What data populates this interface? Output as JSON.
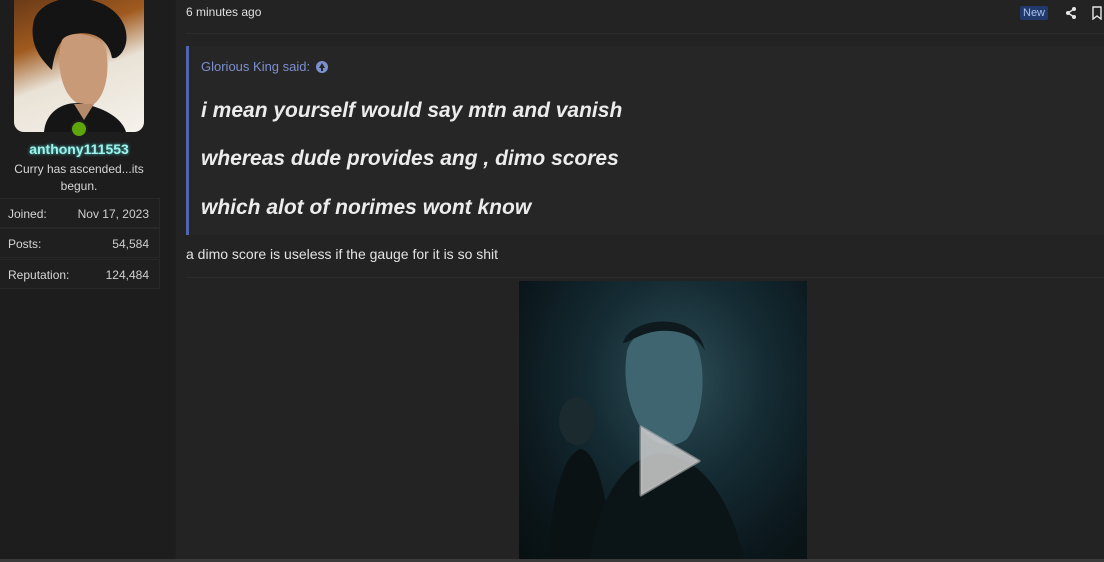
{
  "sidebar": {
    "username": "anthony111553",
    "user_title": "Curry has ascended...its begun.",
    "stats": [
      {
        "label": "Joined:",
        "value": "Nov 17, 2023"
      },
      {
        "label": "Posts:",
        "value": "54,584"
      },
      {
        "label": "Reputation:",
        "value": "124,484"
      }
    ],
    "online_status_color": "#5ea50a",
    "username_color": "#9ef2ec"
  },
  "post": {
    "time": "6 minutes ago",
    "badge": "New",
    "icons": [
      "share-icon",
      "bookmark-icon"
    ],
    "quote": {
      "author_said": "Glorious King said:",
      "lines": [
        "i mean yourself would say mtn and vanish",
        "whereas dude provides ang , dimo scores",
        "which alot of norimes wont know"
      ],
      "accent_color": "#5166b0"
    },
    "reply": "a dimo score is useless if the gauge for it is so shit",
    "media": {
      "type": "video",
      "icon": "play-icon"
    }
  }
}
